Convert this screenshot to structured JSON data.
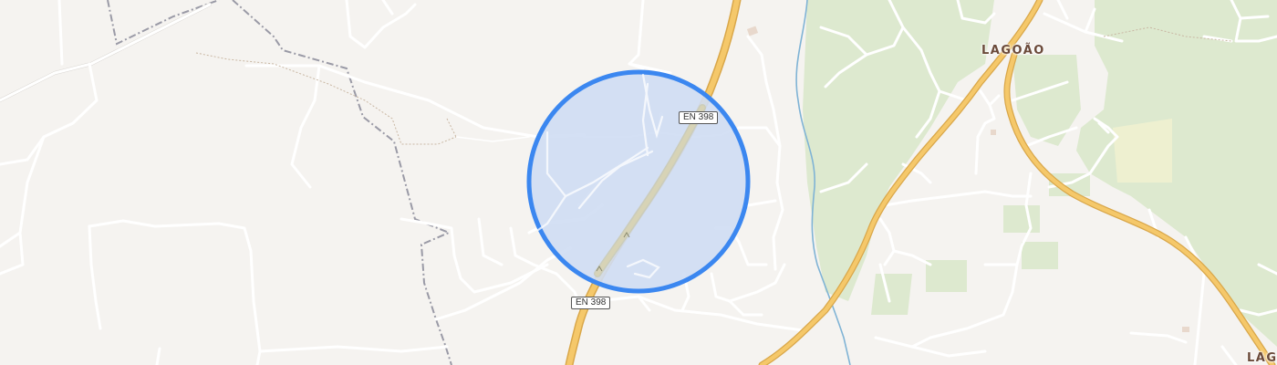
{
  "map": {
    "colors": {
      "background": "#f5f3f0",
      "forest": "#dde9cf",
      "park": "#e6eecf",
      "minor_road": "#ffffff",
      "main_road": "#f5c86a",
      "water": "#7fb3d5",
      "boundary": "#9a9aa6",
      "accuracy_fill": "#cfddf3",
      "accuracy_stroke": "#3b87f0"
    },
    "road_shields": [
      {
        "id": "en398-upper",
        "label": "EN 398"
      },
      {
        "id": "en398-lower",
        "label": "EN 398"
      }
    ],
    "places": [
      {
        "id": "lagoao",
        "label": "LAGOÃO"
      },
      {
        "id": "lag-partial",
        "label": "LAG"
      }
    ]
  }
}
